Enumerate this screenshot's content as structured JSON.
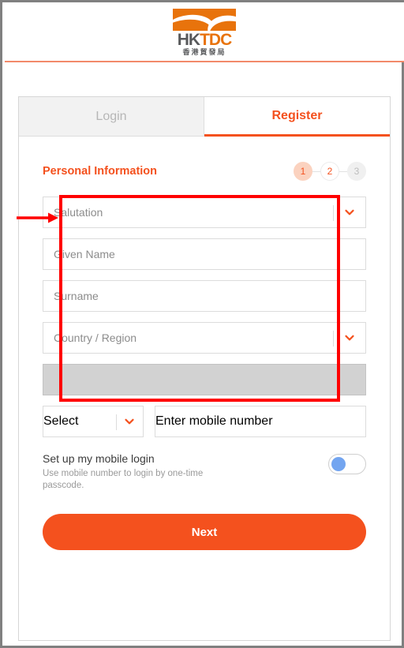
{
  "brand": {
    "logo_word_part1": "HK",
    "logo_word_part2": "TDC",
    "logo_chinese": "香港貿發局",
    "logo_icon": "hktdc-logo-icon",
    "accent_color": "#f4511e",
    "logo_orange": "#e8730c",
    "divider_color": "#f28a6a"
  },
  "tabs": [
    {
      "label": "Login",
      "active": false
    },
    {
      "label": "Register",
      "active": true
    }
  ],
  "form": {
    "section_title": "Personal Information",
    "steps": [
      {
        "label": "1",
        "state": "current"
      },
      {
        "label": "2",
        "state": "next"
      },
      {
        "label": "3",
        "state": "todo"
      }
    ],
    "fields": {
      "salutation": {
        "placeholder": "Salutation",
        "value": "",
        "type": "select"
      },
      "given_name": {
        "placeholder": "Given Name",
        "value": "",
        "type": "text"
      },
      "surname": {
        "placeholder": "Surname",
        "value": "",
        "type": "text"
      },
      "country_region": {
        "placeholder": "Country / Region",
        "value": "",
        "type": "select"
      },
      "masked_field": {
        "placeholder": "",
        "value": "",
        "type": "blank"
      },
      "mobile_code": {
        "placeholder": "Select",
        "value": "",
        "type": "select"
      },
      "mobile_number": {
        "placeholder": "Enter mobile number",
        "value": "",
        "type": "text"
      }
    },
    "mobile_login": {
      "title": "Set up my mobile login",
      "description": "Use mobile number to login by one-time passcode.",
      "toggle_state": "off",
      "knob_color": "#73a5f0"
    },
    "submit_label": "Next"
  },
  "annotations": {
    "highlight_color": "#ff0000",
    "highlight_target": "personal-information-fields",
    "arrow_target": "salutation-field"
  }
}
